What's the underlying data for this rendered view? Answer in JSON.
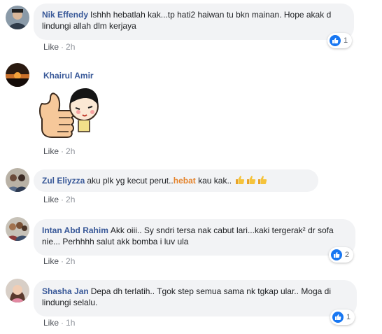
{
  "colors": {
    "author": "#385898",
    "bubble": "#f2f3f5",
    "meta": "#90949c",
    "like_badge": "#1877f2",
    "highlight": "#e4832b"
  },
  "comments": [
    {
      "author": "Nik Effendy",
      "text": "Ishhh hebatlah kak...tp hati2 haiwan tu bkn mainan. Hope akak d lindungi allah dlm kerjaya",
      "like_label": "Like",
      "time": "2h",
      "reaction_count": "1",
      "avatar_icon": "man-avatar-icon"
    },
    {
      "author": "Khairul Amir",
      "sticker": "thumbs-up-cartoon-sticker",
      "like_label": "Like",
      "time": "2h",
      "avatar_icon": "sunset-avatar-icon"
    },
    {
      "author": "Zul Eliyzza",
      "text_before": "aku plk yg kecut perut..",
      "text_highlight": "hebat",
      "text_after": " kau kak..",
      "emojis": [
        "thumbs-up-emoji",
        "thumbs-up-emoji",
        "thumbs-up-emoji"
      ],
      "like_label": "Like",
      "time": "2h",
      "avatar_icon": "group-avatar-icon"
    },
    {
      "author": "Intan Abd Rahim",
      "text": "Akk oiii.. Sy sndri tersa nak cabut lari...kaki tergerak² dr sofa nie... Perhhhh salut akk bomba i luv ula",
      "like_label": "Like",
      "time": "2h",
      "reaction_count": "2",
      "avatar_icon": "group-avatar-icon"
    },
    {
      "author": "Shasha Jan",
      "text": "Depa dh terlatih.. Tgok step semua sama nk tgkap ular.. Moga di lindungi selalu.",
      "like_label": "Like",
      "time": "1h",
      "reaction_count": "1",
      "avatar_icon": "woman-avatar-icon"
    }
  ]
}
